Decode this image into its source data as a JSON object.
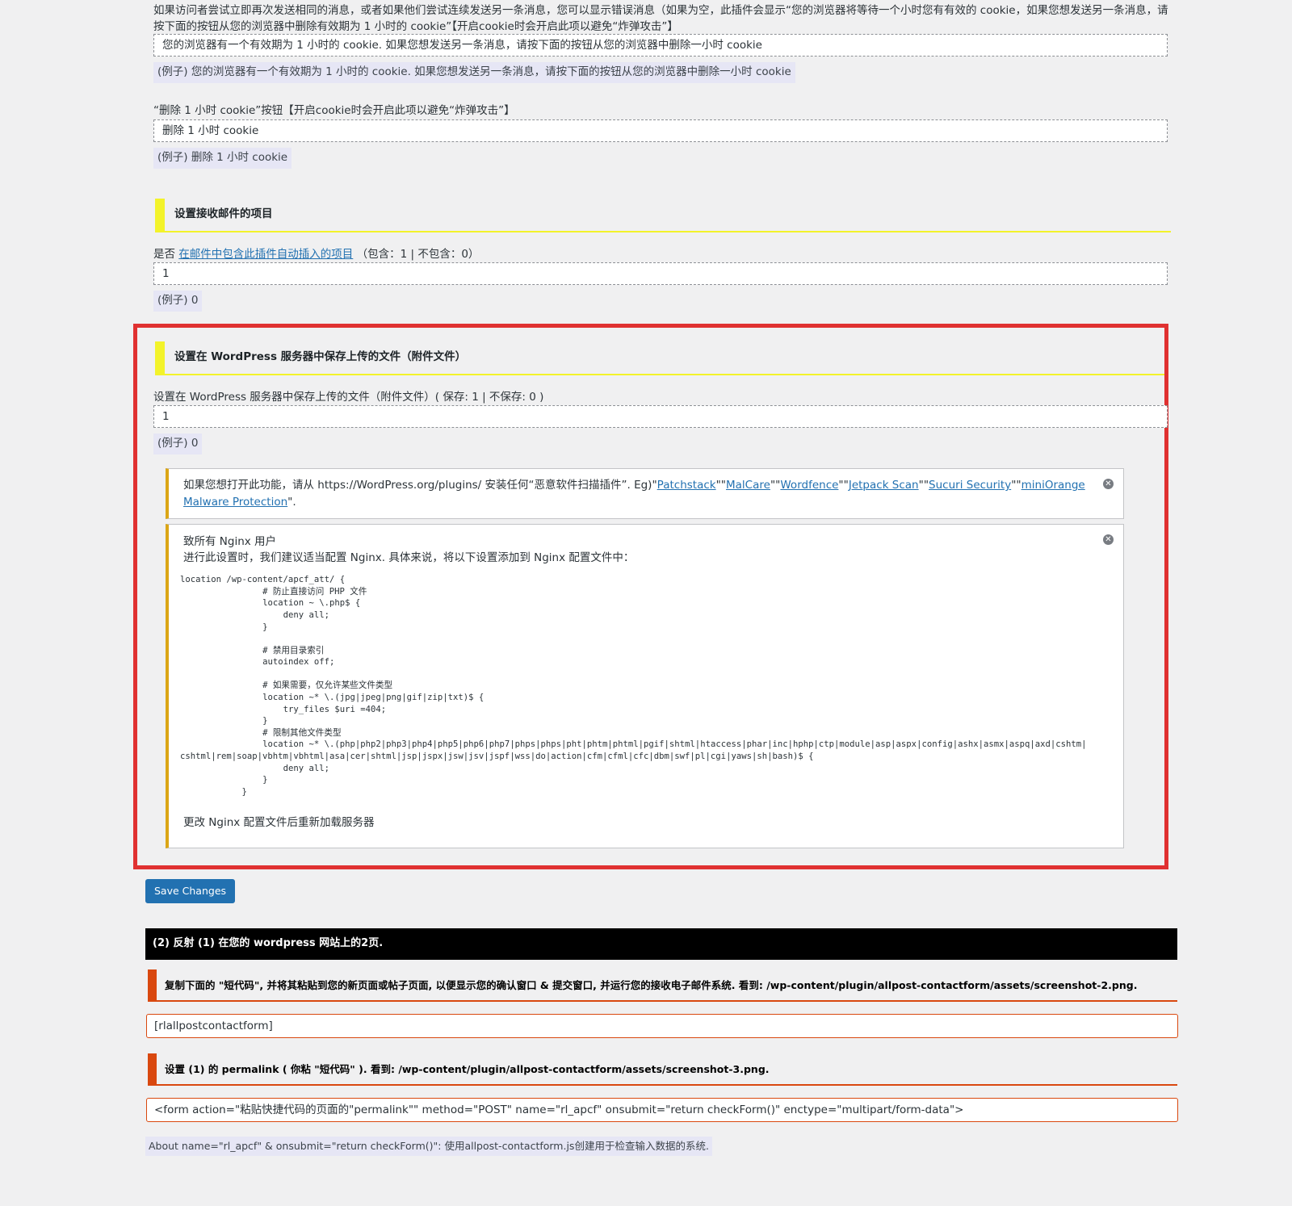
{
  "section_cookie": {
    "error_desc": "如果访问者尝试立即再次发送相同的消息，或者如果他们尝试连续发送另一条消息，您可以显示错误消息（如果为空，此插件会显示“您的浏览器将等待一个小时您有有效的 cookie，如果您想发送另一条消息，请按下面的按钮从您的浏览器中删除有效期为 1 小时的 cookie”【开启cookie时会开启此项以避免“炸弹攻击”】",
    "error_value": "您的浏览器有一个有效期为 1 小时的 cookie. 如果您想发送另一条消息，请按下面的按钮从您的浏览器中删除一小时 cookie",
    "error_example": "(例子) 您的浏览器有一个有效期为 1 小时的 cookie. 如果您想发送另一条消息，请按下面的按钮从您的浏览器中删除一小时 cookie",
    "button_desc": "“删除 1 小时 cookie”按钮【开启cookie时会开启此项以避免“炸弹攻击”】",
    "button_value": "删除 1 小时 cookie",
    "button_example": "(例子) 删除 1 小时 cookie"
  },
  "section_mail": {
    "heading": "设置接收邮件的项目",
    "desc_prefix": "是否",
    "desc_link": "在邮件中包含此插件自动插入的项目",
    "desc_suffix": "（包含：1 | 不包含：0）",
    "value": "1",
    "example": "(例子) 0"
  },
  "section_upload": {
    "heading": "设置在 WordPress 服务器中保存上传的文件（附件文件）",
    "desc": "设置在 WordPress 服务器中保存上传的文件（附件文件）( 保存: 1 | 不保存: 0 )",
    "value": "1",
    "example": "(例子) 0"
  },
  "notice_malware": {
    "text_prefix": "如果您想打开此功能，请从 https://WordPress.org/plugins/ 安装任何“恶意软件扫描插件”. Eg)\"",
    "links": [
      "Patchstack",
      "MalCare",
      "Wordfence",
      "Jetpack Scan",
      "Sucuri Security",
      "miniOrange Malware Protection"
    ],
    "sep": "\"\"",
    "text_suffix": "\"."
  },
  "notice_nginx": {
    "title": "致所有 Nginx 用户",
    "intro": "进行此设置时，我们建议适当配置 Nginx. 具体来说，将以下设置添加到 Nginx 配置文件中：",
    "code": "location /wp-content/apcf_att/ {\n                # 防止直接访问 PHP 文件\n                location ~ \\.php$ {\n                    deny all;\n                }\n\n                # 禁用目录索引\n                autoindex off;\n\n                # 如果需要，仅允许某些文件类型\n                location ~* \\.(jpg|jpeg|png|gif|zip|txt)$ {\n                    try_files $uri =404;\n                }\n                # 限制其他文件类型\n                location ~* \\.(php|php2|php3|php4|php5|php6|php7|phps|phps|pht|phtm|phtml|pgif|shtml|htaccess|phar|inc|hphp|ctp|module|asp|aspx|config|ashx|asmx|aspq|axd|cshtm|cshtml|rem|soap|vbhtm|vbhtml|asa|cer|shtml|jsp|jspx|jsw|jsv|jspf|wss|do|action|cfm|cfml|cfc|dbm|swf|pl|cgi|yaws|sh|bash)$ {\n                    deny all;\n                }\n            }",
    "footer": "更改 Nginx 配置文件后重新加载服务器"
  },
  "save_button": "Save Changes",
  "reflect": {
    "bar": "(2) 反射 (1) 在您的 wordpress 网站上的2页.",
    "step1": "复制下面的 \"短代码\", 并将其粘贴到您的新页面或帖子页面, 以便显示您的确认窗口 & 提交窗口, 并运行您的接收电子邮件系统. 看到: /wp-content/plugin/allpost-contactform/assets/screenshot-2.png.",
    "shortcode": "[rlallpostcontactform]",
    "step2": "设置 (1) 的 permalink ( 你粘 \"短代码\" ). 看到: /wp-content/plugin/allpost-contactform/assets/screenshot-3.png.",
    "form_tag": "<form action=\"粘贴快捷代码的页面的\"permalink\"\" method=\"POST\" name=\"rl_apcf\"  onsubmit=\"return checkForm()\" enctype=\"multipart/form-data\">",
    "about": "About name=\"rl_apcf\" & onsubmit=\"return checkForm()\": 使用allpost-contactform.js创建用于检查输入数据的系统."
  },
  "colors": {
    "yellow_accent": "#f3f32a",
    "red_highlight": "#e03131",
    "orange_accent": "#d9480f",
    "notice_border": "#dba617",
    "button_blue": "#2271b1"
  }
}
